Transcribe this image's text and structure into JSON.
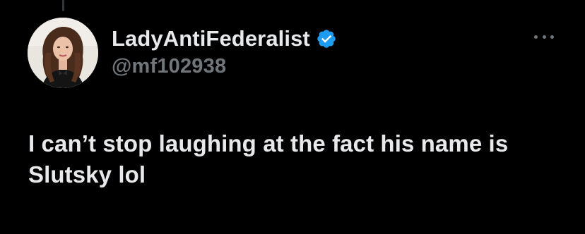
{
  "tweet": {
    "author": {
      "display_name": "LadyAntiFederalist",
      "handle": "@mf102938",
      "verified": true,
      "avatar_icon": "profile-photo"
    },
    "text": "I can’t stop laughing at the fact his name is Slutsky lol",
    "more_icon": "more-options-icon"
  },
  "colors": {
    "background": "#000000",
    "primary_text": "#e7e9ea",
    "secondary_text": "#71767b",
    "verified_badge": "#1d9bf0"
  }
}
